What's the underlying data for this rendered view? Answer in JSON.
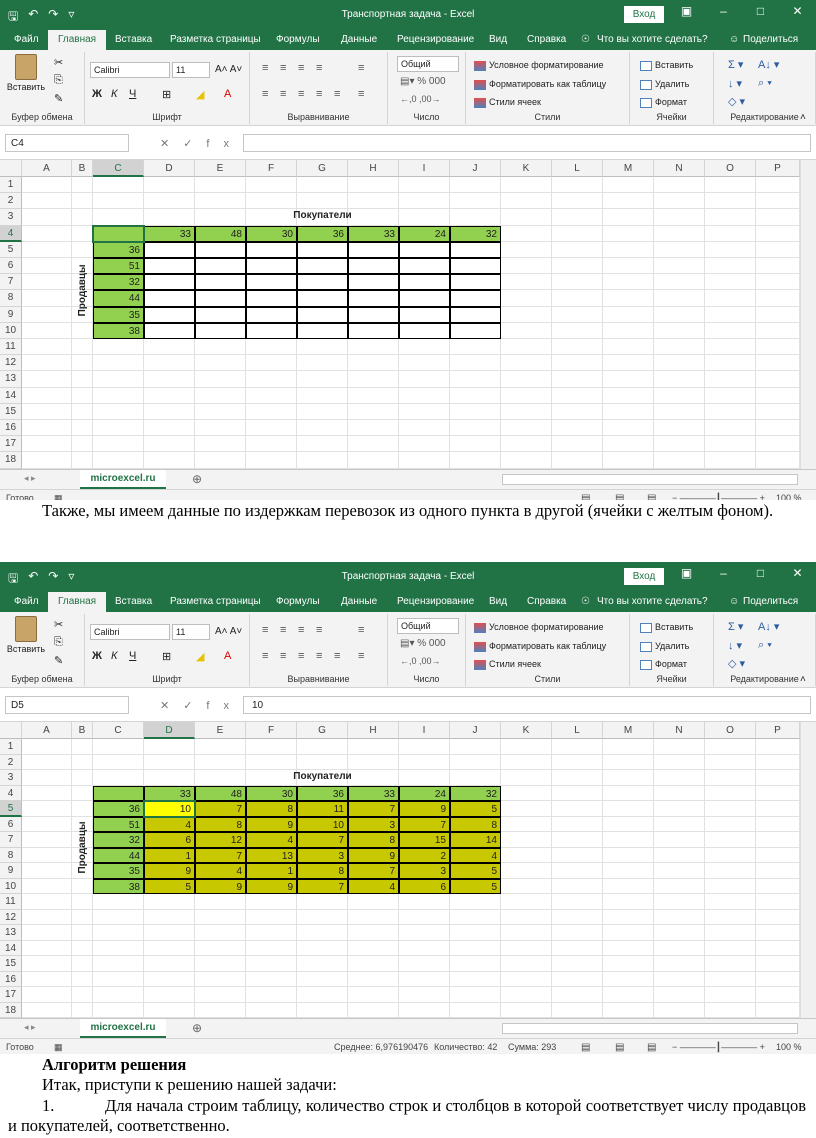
{
  "shot1": {
    "window_title": "Транспортная задача  -  Excel",
    "login": "Вход",
    "tabs": [
      "Файл",
      "Главная",
      "Вставка",
      "Разметка страницы",
      "Формулы",
      "Данные",
      "Рецензирование",
      "Вид",
      "Справка"
    ],
    "tell_me": "Что вы хотите сделать?",
    "share": "Поделиться",
    "ribbon": {
      "paste": "Вставить",
      "clipboard": "Буфер обмена",
      "font_name": "Calibri",
      "font_size": "11",
      "font_group": "Шрифт",
      "align_group": "Выравнивание",
      "number_format": "Общий",
      "number_group": "Число",
      "cond_format": "Условное форматирование",
      "format_table": "Форматировать как таблицу",
      "cell_styles": "Стили ячеек",
      "styles_group": "Стили",
      "insert": "Вставить",
      "delete": "Удалить",
      "format": "Формат",
      "cells_group": "Ячейки",
      "editing_group": "Редактирование"
    },
    "name_box": "C4",
    "formula": "",
    "sheet_tab": "microexcel.ru",
    "status": "Готово",
    "zoom": "100 %",
    "buyers_label": "Покупатели",
    "sellers_label": "Продавцы",
    "demand": [
      33,
      48,
      30,
      36,
      33,
      24,
      32
    ],
    "supply": [
      36,
      51,
      32,
      44,
      35,
      38
    ]
  },
  "paragraph1": "Также, мы имеем данные по издержкам перевозок из одного пункта в другой (ячейки с желтым фоном).",
  "shot2": {
    "window_title": "Транспортная задача  -  Excel",
    "login": "Вход",
    "tabs": [
      "Файл",
      "Главная",
      "Вставка",
      "Разметка страницы",
      "Формулы",
      "Данные",
      "Рецензирование",
      "Вид",
      "Справка"
    ],
    "tell_me": "Что вы хотите сделать?",
    "share": "Поделиться",
    "name_box": "D5",
    "formula": "10",
    "sheet_tab": "microexcel.ru",
    "status": "Готово",
    "avg": "Среднее: 6,976190476",
    "count": "Количество: 42",
    "sum": "Сумма: 293",
    "zoom": "100 %",
    "buyers_label": "Покупатели",
    "sellers_label": "Продавцы",
    "demand": [
      33,
      48,
      30,
      36,
      33,
      24,
      32
    ],
    "supply": [
      36,
      51,
      32,
      44,
      35,
      38
    ],
    "costs": [
      [
        10,
        7,
        8,
        11,
        7,
        9,
        5
      ],
      [
        4,
        8,
        9,
        10,
        3,
        7,
        8
      ],
      [
        6,
        12,
        4,
        7,
        8,
        15,
        14
      ],
      [
        1,
        7,
        13,
        3,
        9,
        2,
        4
      ],
      [
        9,
        4,
        1,
        8,
        7,
        3,
        5
      ],
      [
        5,
        9,
        9,
        7,
        4,
        6,
        5
      ]
    ]
  },
  "heading": "Алгоритм решения",
  "paragraph2": "Итак, приступи к решению нашей задачи:",
  "list_num": "1.",
  "list_item": "Для начала строим таблицу, количество строк и столбцов в которой соответствует числу продавцов и покупателей, соответственно.",
  "colors": {
    "excel_green": "#217346",
    "header_green": "#92d050",
    "cost_yellow": "#c8c800",
    "active_yellow": "#ffff00"
  }
}
